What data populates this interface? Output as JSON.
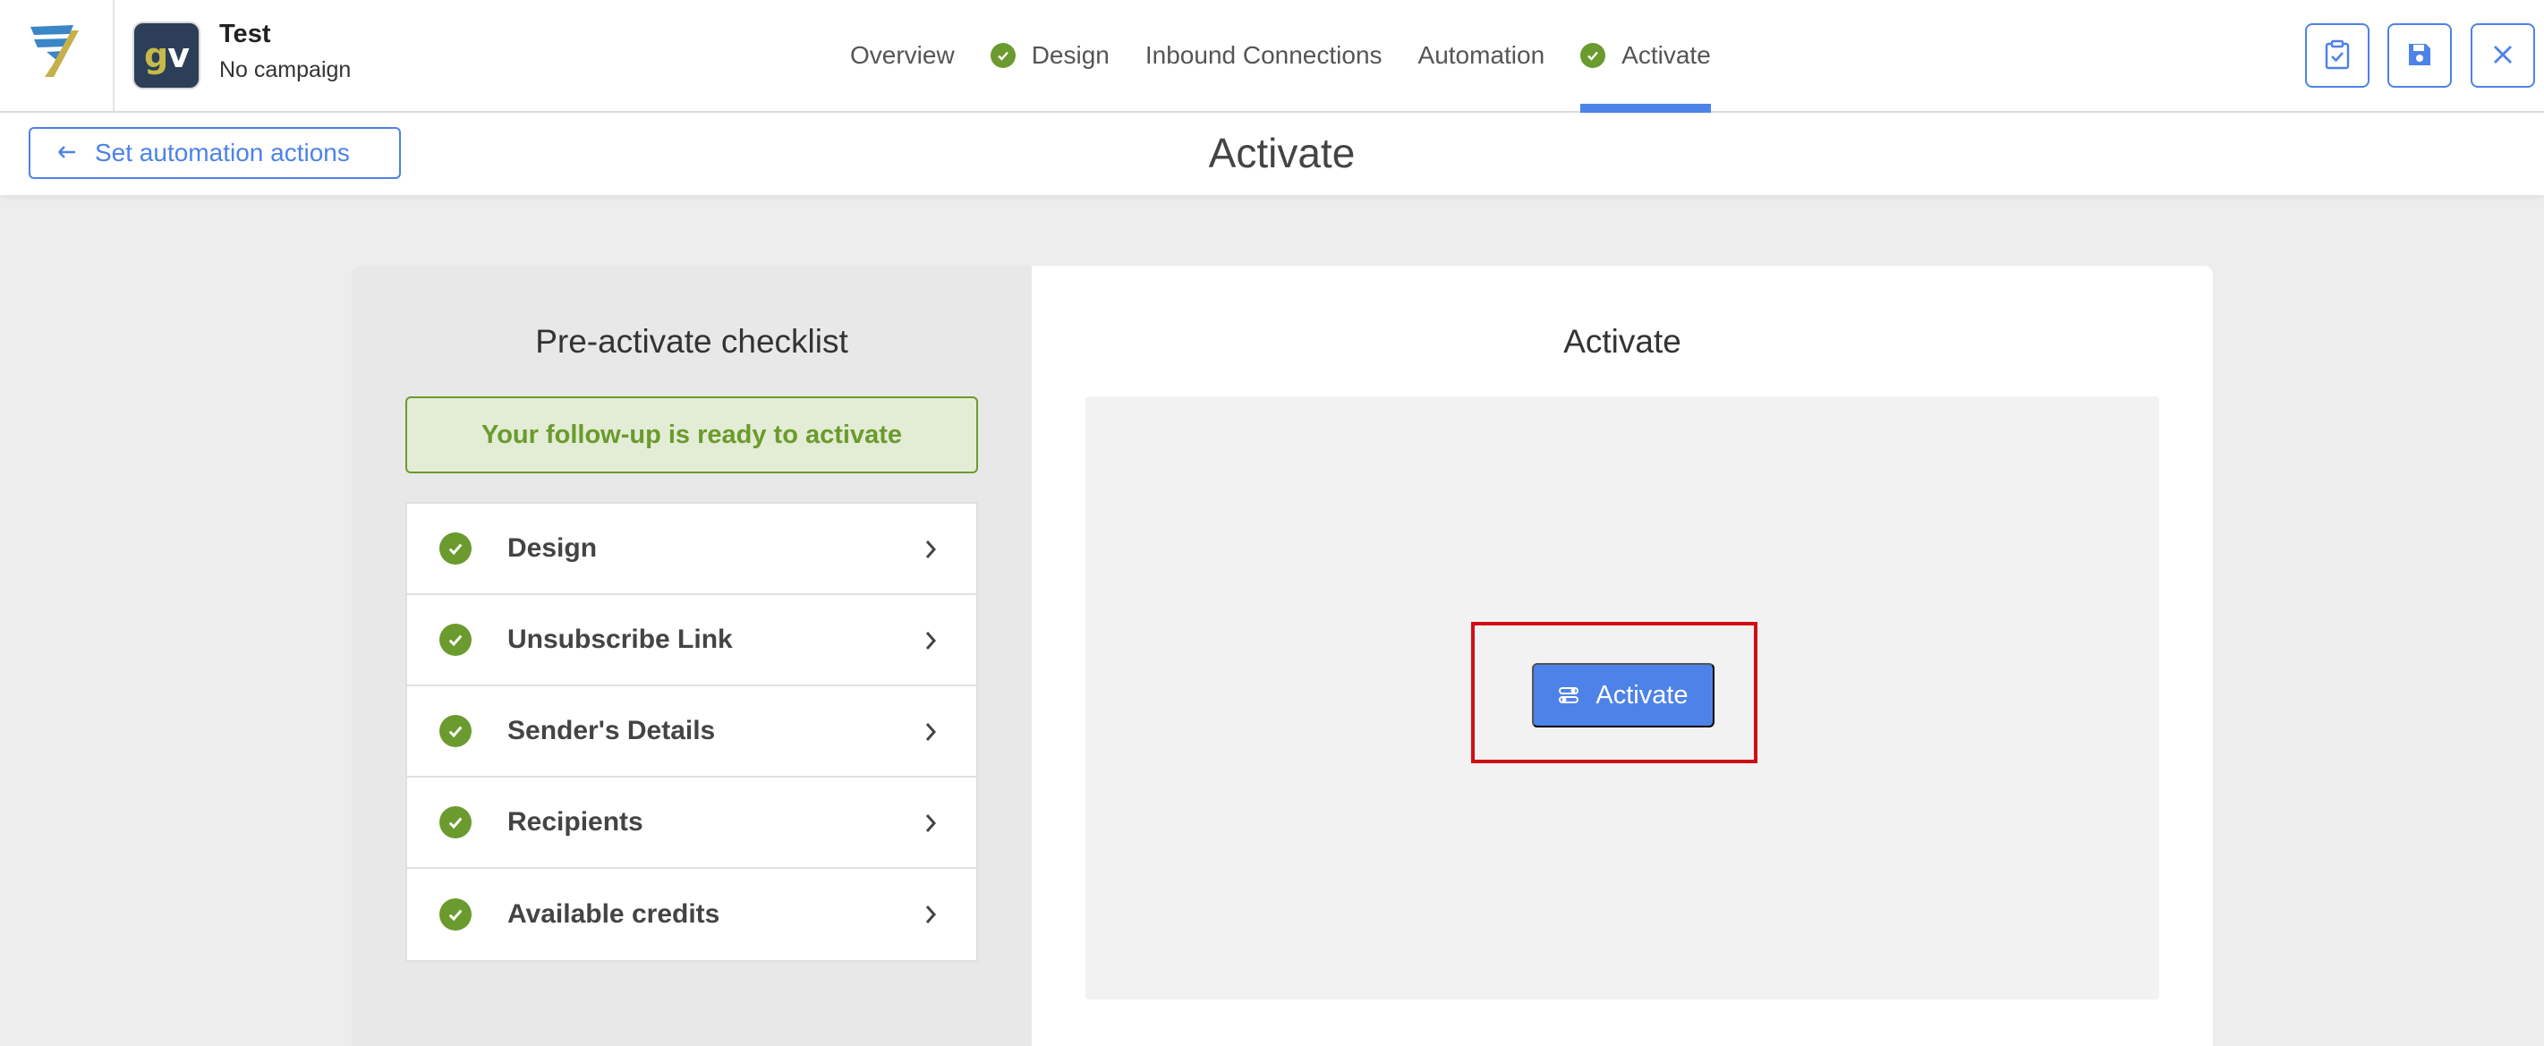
{
  "account": {
    "avatar_initials_1": "g",
    "avatar_initials_2": "v",
    "title": "Test",
    "subtitle": "No campaign"
  },
  "steps": [
    {
      "label": "Overview",
      "done": false
    },
    {
      "label": "Design",
      "done": true
    },
    {
      "label": "Inbound Connections",
      "done": false
    },
    {
      "label": "Automation",
      "done": false
    },
    {
      "label": "Activate",
      "done": true,
      "active": true
    }
  ],
  "toolbar": {
    "checklist_icon": "clipboard-check-icon",
    "save_icon": "floppy-disk-icon",
    "close_icon": "close-icon"
  },
  "subheader": {
    "back_label": "Set automation actions",
    "page_title": "Activate"
  },
  "checklist_panel": {
    "title": "Pre-activate checklist",
    "ready_message": "Your follow-up is ready to activate",
    "items": [
      {
        "label": "Design"
      },
      {
        "label": "Unsubscribe Link"
      },
      {
        "label": "Sender's Details"
      },
      {
        "label": "Recipients"
      },
      {
        "label": "Available credits"
      }
    ]
  },
  "activate_panel": {
    "title": "Activate",
    "button_label": "Activate"
  },
  "colors": {
    "accent": "#4d82e8",
    "success": "#6b9a2e",
    "highlight": "#d00d14"
  }
}
